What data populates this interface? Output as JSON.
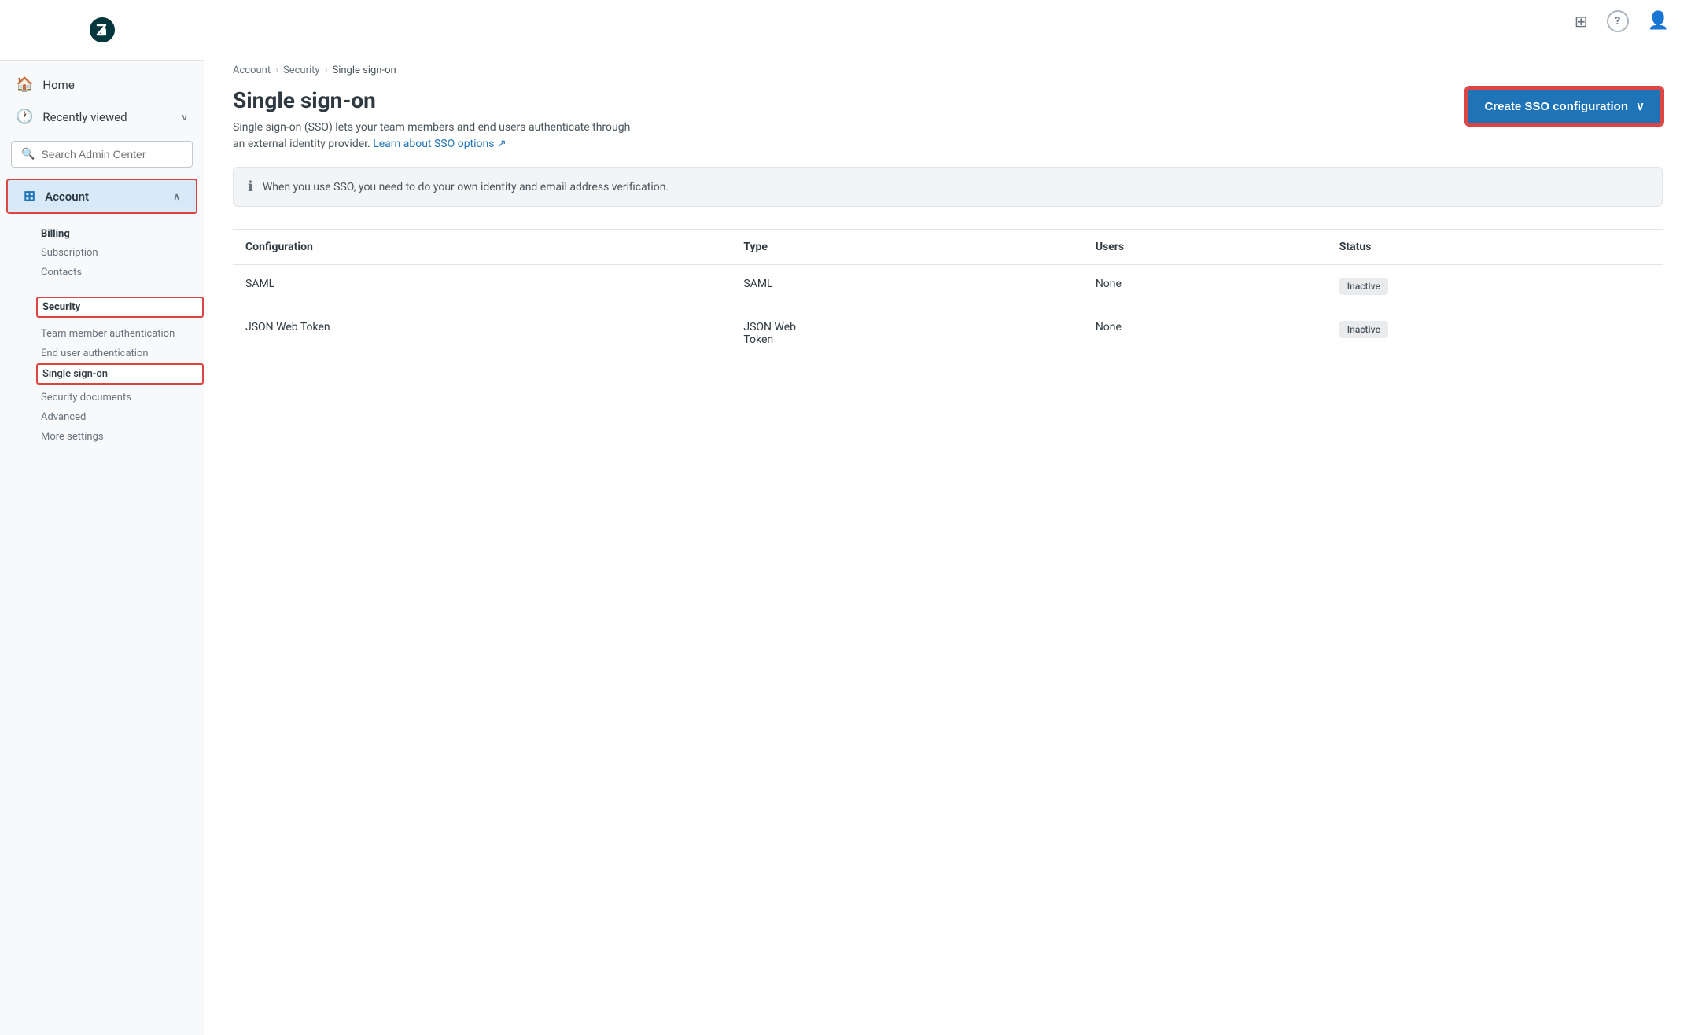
{
  "sidebar": {
    "logo_alt": "Zendesk logo",
    "nav": [
      {
        "id": "home",
        "label": "Home",
        "icon": "🏠"
      },
      {
        "id": "recently-viewed",
        "label": "Recently viewed",
        "icon": "🕐",
        "has_chevron": true
      }
    ],
    "search": {
      "placeholder": "Search Admin Center"
    },
    "account_section": {
      "label": "Account",
      "icon": "⊞",
      "chevron": "∧",
      "subsections": [
        {
          "heading": "Billing",
          "items": [
            "Subscription",
            "Contacts"
          ]
        },
        {
          "heading": "Security",
          "items": [
            "Team member authentication",
            "End user authentication",
            "Single sign-on",
            "Security documents",
            "Advanced",
            "More settings"
          ]
        }
      ]
    }
  },
  "topbar": {
    "grid_icon": "⊞",
    "help_icon": "?",
    "user_icon": "👤"
  },
  "breadcrumb": {
    "items": [
      "Account",
      "Security",
      "Single sign-on"
    ],
    "separator": "›"
  },
  "page": {
    "title": "Single sign-on",
    "description": "Single sign-on (SSO) lets your team members and end users authenticate through an external identity provider.",
    "learn_link_text": "Learn about SSO options",
    "create_button_label": "Create SSO configuration",
    "create_button_chevron": "∨",
    "info_message": "When you use SSO, you need to do your own identity and email address verification.",
    "table": {
      "columns": [
        "Configuration",
        "Type",
        "Users",
        "Status"
      ],
      "rows": [
        {
          "configuration": "SAML",
          "type": "SAML",
          "users": "None",
          "status": "Inactive"
        },
        {
          "configuration": "JSON Web Token",
          "type": "JSON Web Token",
          "users": "None",
          "status": "Inactive"
        }
      ]
    }
  }
}
